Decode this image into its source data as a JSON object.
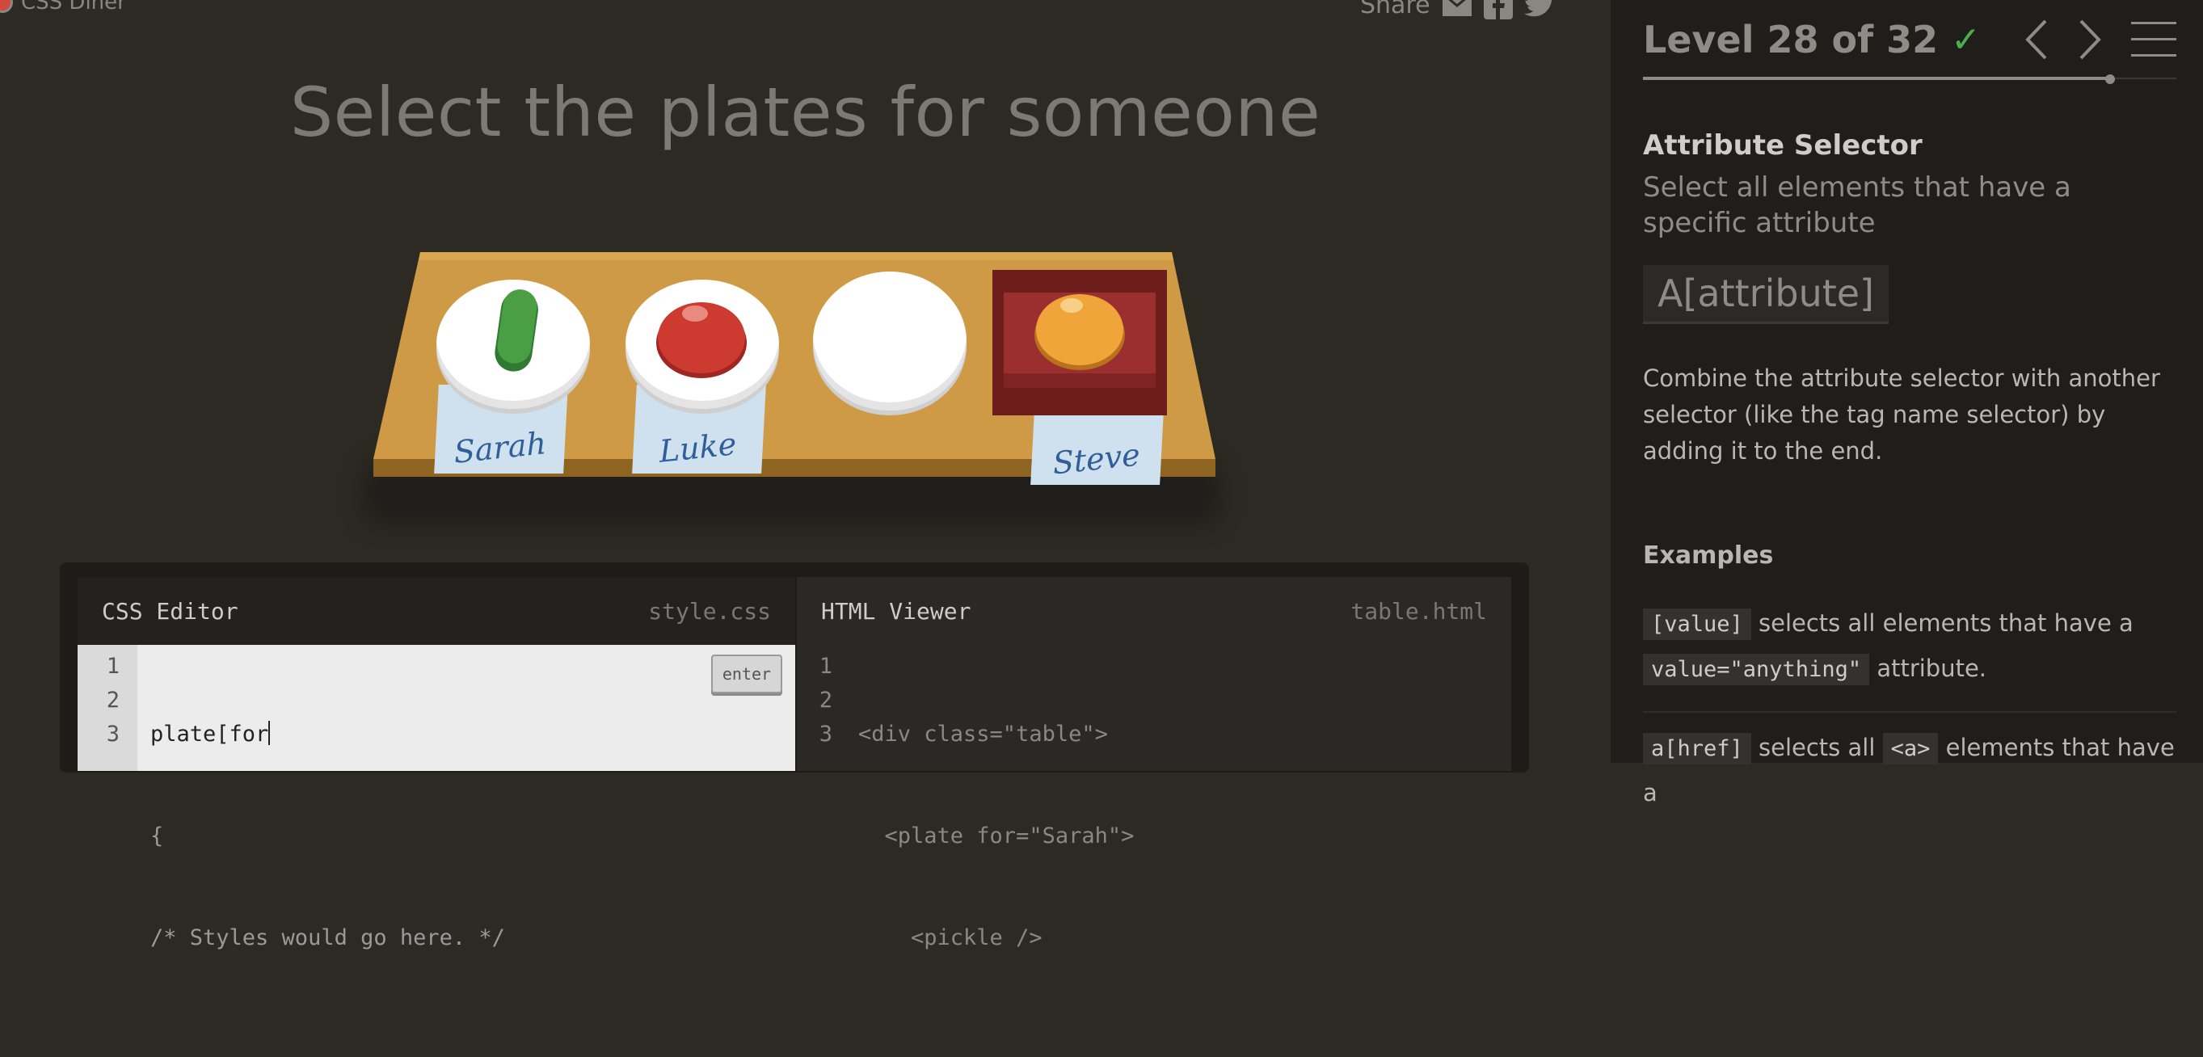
{
  "app": {
    "name": "CSS Diner"
  },
  "share": {
    "label": "Share",
    "icons": [
      "mail-icon",
      "facebook-icon",
      "twitter-icon"
    ]
  },
  "order": {
    "instruction": "Select the plates for someone"
  },
  "table": {
    "plates": [
      {
        "name": "Sarah",
        "item": "pickle"
      },
      {
        "name": "Luke",
        "item": "apple"
      },
      {
        "name": "",
        "item": ""
      },
      {
        "name": "Steve",
        "item": "orange in bento"
      }
    ]
  },
  "css_editor": {
    "title": "CSS Editor",
    "file": "style.css",
    "line_numbers": [
      "1",
      "2",
      "3"
    ],
    "input_value": "plate[for",
    "line2": "{",
    "line3": "/* Styles would go here. */",
    "enter_label": "enter"
  },
  "html_viewer": {
    "title": "HTML Viewer",
    "file": "table.html",
    "line_numbers": [
      "1",
      "2",
      "3"
    ],
    "lines": [
      "<div class=\"table\">",
      "  <plate for=\"Sarah\">",
      "    <pickle />"
    ]
  },
  "level": {
    "title": "Level 28 of 32",
    "completed": true,
    "progress_fraction": 0.875
  },
  "lesson": {
    "selector_name": "Attribute Selector",
    "title": "Select all elements that have a specific attribute",
    "syntax": "A[attribute]",
    "hint": "Combine the attribute selector with another selector (like the tag name selector) by adding it to the end.",
    "examples_heading": "Examples",
    "example1": {
      "code1": "[value]",
      "text1": "selects all elements that have a",
      "code2": "value=\"anything\"",
      "text2": "attribute."
    },
    "example2": {
      "code1": "a[href]",
      "text1": "selects all",
      "code2": "<a>",
      "text2": "elements that have a"
    }
  },
  "colors": {
    "accent_check": "#4cae4c",
    "table_wood": "#cf9a45",
    "bento": "#9b2f2f"
  }
}
